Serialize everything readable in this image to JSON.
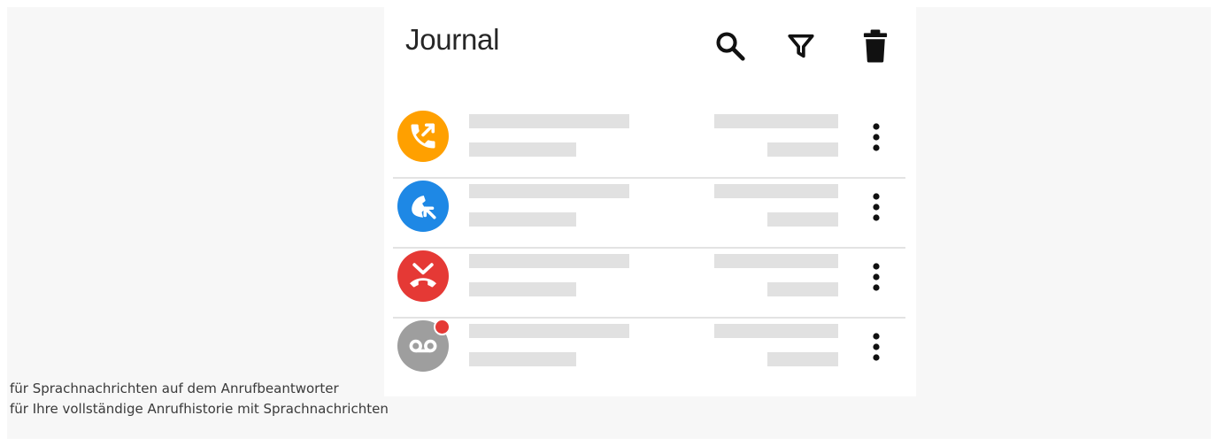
{
  "journal": {
    "title": "Journal",
    "toolbar": {
      "search_icon": "search-icon",
      "filter_icon": "filter-icon",
      "delete_icon": "trash-icon"
    }
  },
  "calls": [
    {
      "type": "outgoing",
      "icon": "outgoing-call-icon",
      "color": "#ffa000"
    },
    {
      "type": "incoming",
      "icon": "incoming-call-icon",
      "color": "#1e88e5"
    },
    {
      "type": "missed",
      "icon": "missed-call-icon",
      "color": "#e53935"
    },
    {
      "type": "voicemail",
      "icon": "voicemail-icon",
      "color": "#9e9e9e",
      "badge_color": "#e53935"
    }
  ],
  "captions": [
    "für Sprachnachrichten auf dem Anrufbeantworter",
    "für Ihre vollständige Anrufhistorie mit Sprachnachrichten"
  ],
  "colors": {
    "page_background": "#f7f7f7",
    "panel_background": "#ffffff",
    "placeholder": "#e1e1e1",
    "divider": "#e3e3e3"
  }
}
